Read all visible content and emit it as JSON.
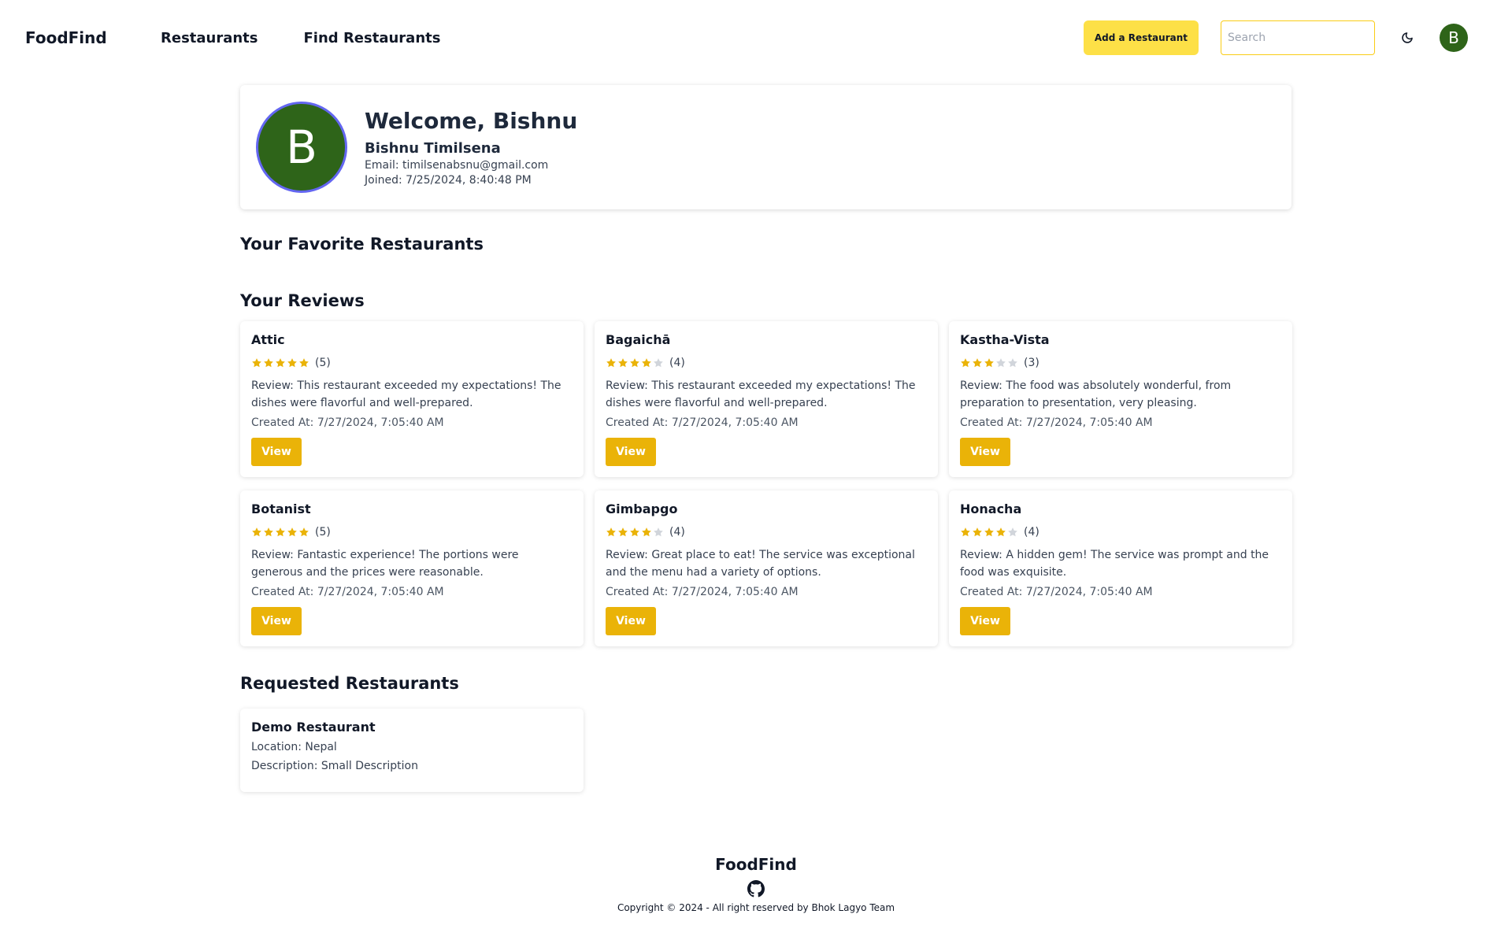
{
  "navbar": {
    "brand": "FoodFind",
    "links": [
      "Restaurants",
      "Find Restaurants"
    ],
    "add_button": "Add a Restaurant",
    "search_placeholder": "Search",
    "avatar_initial": "B"
  },
  "profile": {
    "initial": "B",
    "welcome": "Welcome, Bishnu",
    "full_name": "Bishnu Timilsena",
    "email": "Email: timilsenabsnu@gmail.com",
    "joined": "Joined: 7/25/2024, 8:40:48 PM"
  },
  "sections": {
    "favorites": "Your Favorite Restaurants",
    "reviews": "Your Reviews",
    "requested": "Requested Restaurants"
  },
  "reviews": [
    {
      "name": "Attic",
      "rating": 5,
      "count": "(5)",
      "text": "Review: This restaurant exceeded my expectations! The dishes were flavorful and well-prepared.",
      "created": "Created At: 7/27/2024, 7:05:40 AM",
      "button": "View"
    },
    {
      "name": "Bagaichā",
      "rating": 4,
      "count": "(4)",
      "text": "Review: This restaurant exceeded my expectations! The dishes were flavorful and well-prepared.",
      "created": "Created At: 7/27/2024, 7:05:40 AM",
      "button": "View"
    },
    {
      "name": "Kastha-Vista",
      "rating": 3,
      "count": "(3)",
      "text": "Review: The food was absolutely wonderful, from preparation to presentation, very pleasing.",
      "created": "Created At: 7/27/2024, 7:05:40 AM",
      "button": "View"
    },
    {
      "name": "Botanist",
      "rating": 5,
      "count": "(5)",
      "text": "Review: Fantastic experience! The portions were generous and the prices were reasonable.",
      "created": "Created At: 7/27/2024, 7:05:40 AM",
      "button": "View"
    },
    {
      "name": "Gimbapgo",
      "rating": 4,
      "count": "(4)",
      "text": "Review: Great place to eat! The service was exceptional and the menu had a variety of options.",
      "created": "Created At: 7/27/2024, 7:05:40 AM",
      "button": "View"
    },
    {
      "name": "Honacha",
      "rating": 4,
      "count": "(4)",
      "text": "Review: A hidden gem! The service was prompt and the food was exquisite.",
      "created": "Created At: 7/27/2024, 7:05:40 AM",
      "button": "View"
    }
  ],
  "requested": {
    "name": "Demo Restaurant",
    "location": "Location: Nepal",
    "description": "Description: Small Description"
  },
  "footer": {
    "brand": "FoodFind",
    "icon": "github-icon",
    "copyright": "Copyright © 2024 - All right reserved by Bhok Lagyo Team"
  },
  "colors": {
    "accent": "#eab308",
    "add_button": "#fde047",
    "avatar_bg": "#2e6419",
    "avatar_ring": "#6366f1",
    "star_filled": "#eab308",
    "star_empty": "#d1d5db"
  }
}
